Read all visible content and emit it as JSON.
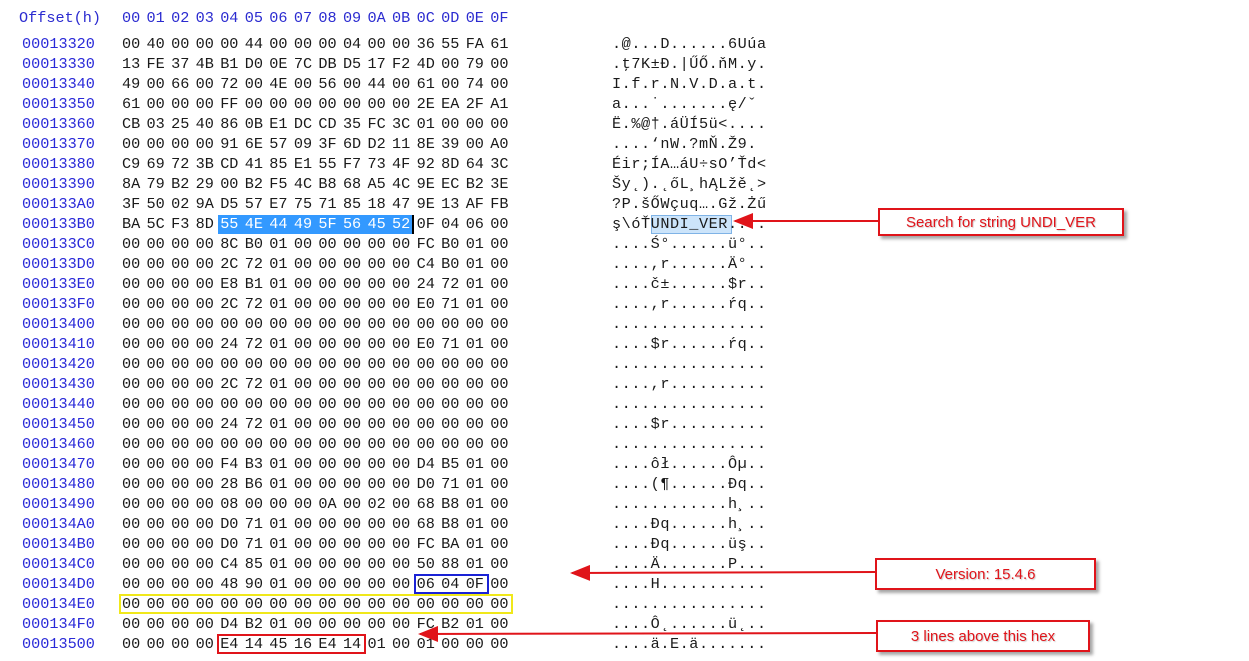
{
  "header": {
    "offset_label": "Offset(h)",
    "columns": [
      "00",
      "01",
      "02",
      "03",
      "04",
      "05",
      "06",
      "07",
      "08",
      "09",
      "0A",
      "0B",
      "0C",
      "0D",
      "0E",
      "0F"
    ]
  },
  "rows": [
    {
      "offset": "00013320",
      "bytes": [
        "00",
        "40",
        "00",
        "00",
        "00",
        "44",
        "00",
        "00",
        "00",
        "04",
        "00",
        "00",
        "36",
        "55",
        "FA",
        "61"
      ],
      "ascii": ".@...D......6Uúa"
    },
    {
      "offset": "00013330",
      "bytes": [
        "13",
        "FE",
        "37",
        "4B",
        "B1",
        "D0",
        "0E",
        "7C",
        "DB",
        "D5",
        "17",
        "F2",
        "4D",
        "00",
        "79",
        "00"
      ],
      "ascii": ".ţ7K±Đ.|ŰŐ.ňM.y."
    },
    {
      "offset": "00013340",
      "bytes": [
        "49",
        "00",
        "66",
        "00",
        "72",
        "00",
        "4E",
        "00",
        "56",
        "00",
        "44",
        "00",
        "61",
        "00",
        "74",
        "00"
      ],
      "ascii": "I.f.r.N.V.D.a.t."
    },
    {
      "offset": "00013350",
      "bytes": [
        "61",
        "00",
        "00",
        "00",
        "FF",
        "00",
        "00",
        "00",
        "00",
        "00",
        "00",
        "00",
        "2E",
        "EA",
        "2F",
        "A1"
      ],
      "ascii": "a...˙.......ę/ˇ"
    },
    {
      "offset": "00013360",
      "bytes": [
        "CB",
        "03",
        "25",
        "40",
        "86",
        "0B",
        "E1",
        "DC",
        "CD",
        "35",
        "FC",
        "3C",
        "01",
        "00",
        "00",
        "00"
      ],
      "ascii": "Ë.%@†.áÜÍ5ü<...."
    },
    {
      "offset": "00013370",
      "bytes": [
        "00",
        "00",
        "00",
        "00",
        "91",
        "6E",
        "57",
        "09",
        "3F",
        "6D",
        "D2",
        "11",
        "8E",
        "39",
        "00",
        "A0"
      ],
      "ascii": "....‘nW.?mŇ.Ž9. "
    },
    {
      "offset": "00013380",
      "bytes": [
        "C9",
        "69",
        "72",
        "3B",
        "CD",
        "41",
        "85",
        "E1",
        "55",
        "F7",
        "73",
        "4F",
        "92",
        "8D",
        "64",
        "3C"
      ],
      "ascii": "Éir;ÍA…áU÷sO’Ťd<"
    },
    {
      "offset": "00013390",
      "bytes": [
        "8A",
        "79",
        "B2",
        "29",
        "00",
        "B2",
        "F5",
        "4C",
        "B8",
        "68",
        "A5",
        "4C",
        "9E",
        "EC",
        "B2",
        "3E"
      ],
      "ascii": "Šy˛).˛őL¸hĄLžě˛>"
    },
    {
      "offset": "000133A0",
      "bytes": [
        "3F",
        "50",
        "02",
        "9A",
        "D5",
        "57",
        "E7",
        "75",
        "71",
        "85",
        "18",
        "47",
        "9E",
        "13",
        "AF",
        "FB"
      ],
      "ascii": "?P.šŐWçuq….Gž.Żű"
    },
    {
      "offset": "000133B0",
      "bytes": [
        "BA",
        "5C",
        "F3",
        "8D",
        "55",
        "4E",
        "44",
        "49",
        "5F",
        "56",
        "45",
        "52",
        "0F",
        "04",
        "06",
        "00"
      ],
      "ascii": "ş\\óŤUNDI_VER...."
    },
    {
      "offset": "000133C0",
      "bytes": [
        "00",
        "00",
        "00",
        "00",
        "8C",
        "B0",
        "01",
        "00",
        "00",
        "00",
        "00",
        "00",
        "FC",
        "B0",
        "01",
        "00"
      ],
      "ascii": "....Ś°......ü°.."
    },
    {
      "offset": "000133D0",
      "bytes": [
        "00",
        "00",
        "00",
        "00",
        "2C",
        "72",
        "01",
        "00",
        "00",
        "00",
        "00",
        "00",
        "C4",
        "B0",
        "01",
        "00"
      ],
      "ascii": "....,r......Ä°.."
    },
    {
      "offset": "000133E0",
      "bytes": [
        "00",
        "00",
        "00",
        "00",
        "E8",
        "B1",
        "01",
        "00",
        "00",
        "00",
        "00",
        "00",
        "24",
        "72",
        "01",
        "00"
      ],
      "ascii": "....č±......$r.."
    },
    {
      "offset": "000133F0",
      "bytes": [
        "00",
        "00",
        "00",
        "00",
        "2C",
        "72",
        "01",
        "00",
        "00",
        "00",
        "00",
        "00",
        "E0",
        "71",
        "01",
        "00"
      ],
      "ascii": "....,r......ŕq.."
    },
    {
      "offset": "00013400",
      "bytes": [
        "00",
        "00",
        "00",
        "00",
        "00",
        "00",
        "00",
        "00",
        "00",
        "00",
        "00",
        "00",
        "00",
        "00",
        "00",
        "00"
      ],
      "ascii": "................"
    },
    {
      "offset": "00013410",
      "bytes": [
        "00",
        "00",
        "00",
        "00",
        "24",
        "72",
        "01",
        "00",
        "00",
        "00",
        "00",
        "00",
        "E0",
        "71",
        "01",
        "00"
      ],
      "ascii": "....$r......ŕq.."
    },
    {
      "offset": "00013420",
      "bytes": [
        "00",
        "00",
        "00",
        "00",
        "00",
        "00",
        "00",
        "00",
        "00",
        "00",
        "00",
        "00",
        "00",
        "00",
        "00",
        "00"
      ],
      "ascii": "................"
    },
    {
      "offset": "00013430",
      "bytes": [
        "00",
        "00",
        "00",
        "00",
        "2C",
        "72",
        "01",
        "00",
        "00",
        "00",
        "00",
        "00",
        "00",
        "00",
        "00",
        "00"
      ],
      "ascii": "....,r.........."
    },
    {
      "offset": "00013440",
      "bytes": [
        "00",
        "00",
        "00",
        "00",
        "00",
        "00",
        "00",
        "00",
        "00",
        "00",
        "00",
        "00",
        "00",
        "00",
        "00",
        "00"
      ],
      "ascii": "................"
    },
    {
      "offset": "00013450",
      "bytes": [
        "00",
        "00",
        "00",
        "00",
        "24",
        "72",
        "01",
        "00",
        "00",
        "00",
        "00",
        "00",
        "00",
        "00",
        "00",
        "00"
      ],
      "ascii": "....$r.........."
    },
    {
      "offset": "00013460",
      "bytes": [
        "00",
        "00",
        "00",
        "00",
        "00",
        "00",
        "00",
        "00",
        "00",
        "00",
        "00",
        "00",
        "00",
        "00",
        "00",
        "00"
      ],
      "ascii": "................"
    },
    {
      "offset": "00013470",
      "bytes": [
        "00",
        "00",
        "00",
        "00",
        "F4",
        "B3",
        "01",
        "00",
        "00",
        "00",
        "00",
        "00",
        "D4",
        "B5",
        "01",
        "00"
      ],
      "ascii": "....ôł......Ôµ.."
    },
    {
      "offset": "00013480",
      "bytes": [
        "00",
        "00",
        "00",
        "00",
        "28",
        "B6",
        "01",
        "00",
        "00",
        "00",
        "00",
        "00",
        "D0",
        "71",
        "01",
        "00"
      ],
      "ascii": "....(¶......Đq.."
    },
    {
      "offset": "00013490",
      "bytes": [
        "00",
        "00",
        "00",
        "00",
        "08",
        "00",
        "00",
        "00",
        "0A",
        "00",
        "02",
        "00",
        "68",
        "B8",
        "01",
        "00"
      ],
      "ascii": "............h¸.."
    },
    {
      "offset": "000134A0",
      "bytes": [
        "00",
        "00",
        "00",
        "00",
        "D0",
        "71",
        "01",
        "00",
        "00",
        "00",
        "00",
        "00",
        "68",
        "B8",
        "01",
        "00"
      ],
      "ascii": "....Đq......h¸.."
    },
    {
      "offset": "000134B0",
      "bytes": [
        "00",
        "00",
        "00",
        "00",
        "D0",
        "71",
        "01",
        "00",
        "00",
        "00",
        "00",
        "00",
        "FC",
        "BA",
        "01",
        "00"
      ],
      "ascii": "....Đq......üş.."
    },
    {
      "offset": "000134C0",
      "bytes": [
        "00",
        "00",
        "00",
        "00",
        "C4",
        "85",
        "01",
        "00",
        "00",
        "00",
        "00",
        "00",
        "50",
        "88",
        "01",
        "00"
      ],
      "ascii": "....Ä.......P..."
    },
    {
      "offset": "000134D0",
      "bytes": [
        "00",
        "00",
        "00",
        "00",
        "48",
        "90",
        "01",
        "00",
        "00",
        "00",
        "00",
        "00",
        "06",
        "04",
        "0F",
        "00"
      ],
      "ascii": "....H..........."
    },
    {
      "offset": "000134E0",
      "bytes": [
        "00",
        "00",
        "00",
        "00",
        "00",
        "00",
        "00",
        "00",
        "00",
        "00",
        "00",
        "00",
        "00",
        "00",
        "00",
        "00"
      ],
      "ascii": "................"
    },
    {
      "offset": "000134F0",
      "bytes": [
        "00",
        "00",
        "00",
        "00",
        "D4",
        "B2",
        "01",
        "00",
        "00",
        "00",
        "00",
        "00",
        "FC",
        "B2",
        "01",
        "00"
      ],
      "ascii": "....Ô˛......ü˛.."
    },
    {
      "offset": "00013500",
      "bytes": [
        "00",
        "00",
        "00",
        "00",
        "E4",
        "14",
        "45",
        "16",
        "E4",
        "14",
        "01",
        "00",
        "01",
        "00",
        "00",
        "00"
      ],
      "ascii": "....ä.E.ä......."
    }
  ],
  "selection": {
    "row": 9,
    "start": 4,
    "end": 11,
    "ascii_text": "UNDI_VER"
  },
  "highlights": [
    {
      "name": "version-bytes-box",
      "row": 27,
      "start": 12,
      "end": 14,
      "color": "#1a22d6"
    },
    {
      "name": "zero-row-box",
      "row": 28,
      "start": 0,
      "end": 15,
      "color": "#f0e81a"
    },
    {
      "name": "marker-bytes-box",
      "row": 30,
      "start": 4,
      "end": 9,
      "color": "#e0141a"
    }
  ],
  "annotations": {
    "search": "Search for string UNDI_VER",
    "version": "Version: 15.4.6",
    "lines_above": "3 lines above this hex"
  },
  "colors": {
    "offset": "#2a2ad8",
    "selection": "#3399ff",
    "annotation": "#e0141a"
  }
}
